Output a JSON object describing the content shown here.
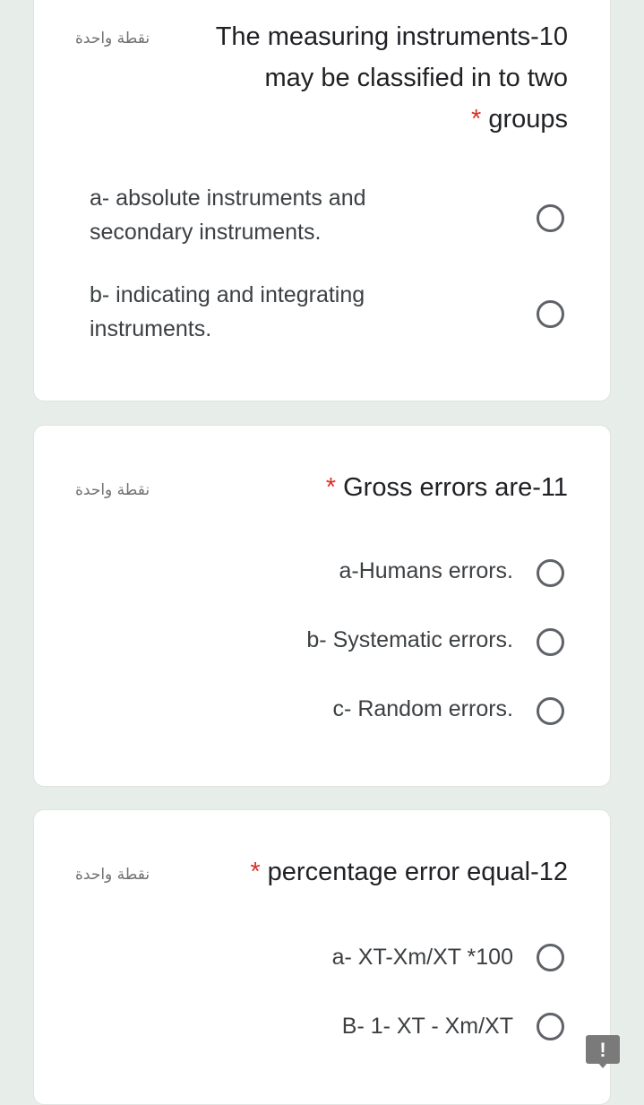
{
  "questions": [
    {
      "points": "نقطة واحدة",
      "title_line1": "The measuring instruments-10",
      "title_line2": "may be classified in to two",
      "title_line3": "groups",
      "required_mark": "*",
      "options": [
        {
          "line1": "a- absolute instruments and",
          "line2": "secondary instruments."
        },
        {
          "line1": "b- indicating and integrating",
          "line2": "instruments."
        }
      ]
    },
    {
      "points": "نقطة واحدة",
      "title": "Gross errors are-11",
      "required_mark": "*",
      "options": [
        {
          "label": "a-Humans errors."
        },
        {
          "label": "b- Systematic errors."
        },
        {
          "label": "c- Random errors."
        }
      ]
    },
    {
      "points": "نقطة واحدة",
      "title": "percentage error equal-12",
      "required_mark": "*",
      "options": [
        {
          "label": "a- XT-Xm/XT *100"
        },
        {
          "label": "B- 1- XT - Xm/XT"
        }
      ]
    }
  ],
  "feedback_button": {
    "icon": "report-issue-icon",
    "glyph": "!"
  },
  "colors": {
    "background": "#e7ede9",
    "card": "#ffffff",
    "required": "#d93025",
    "radio_border": "#5f6368",
    "text": "#202124"
  }
}
